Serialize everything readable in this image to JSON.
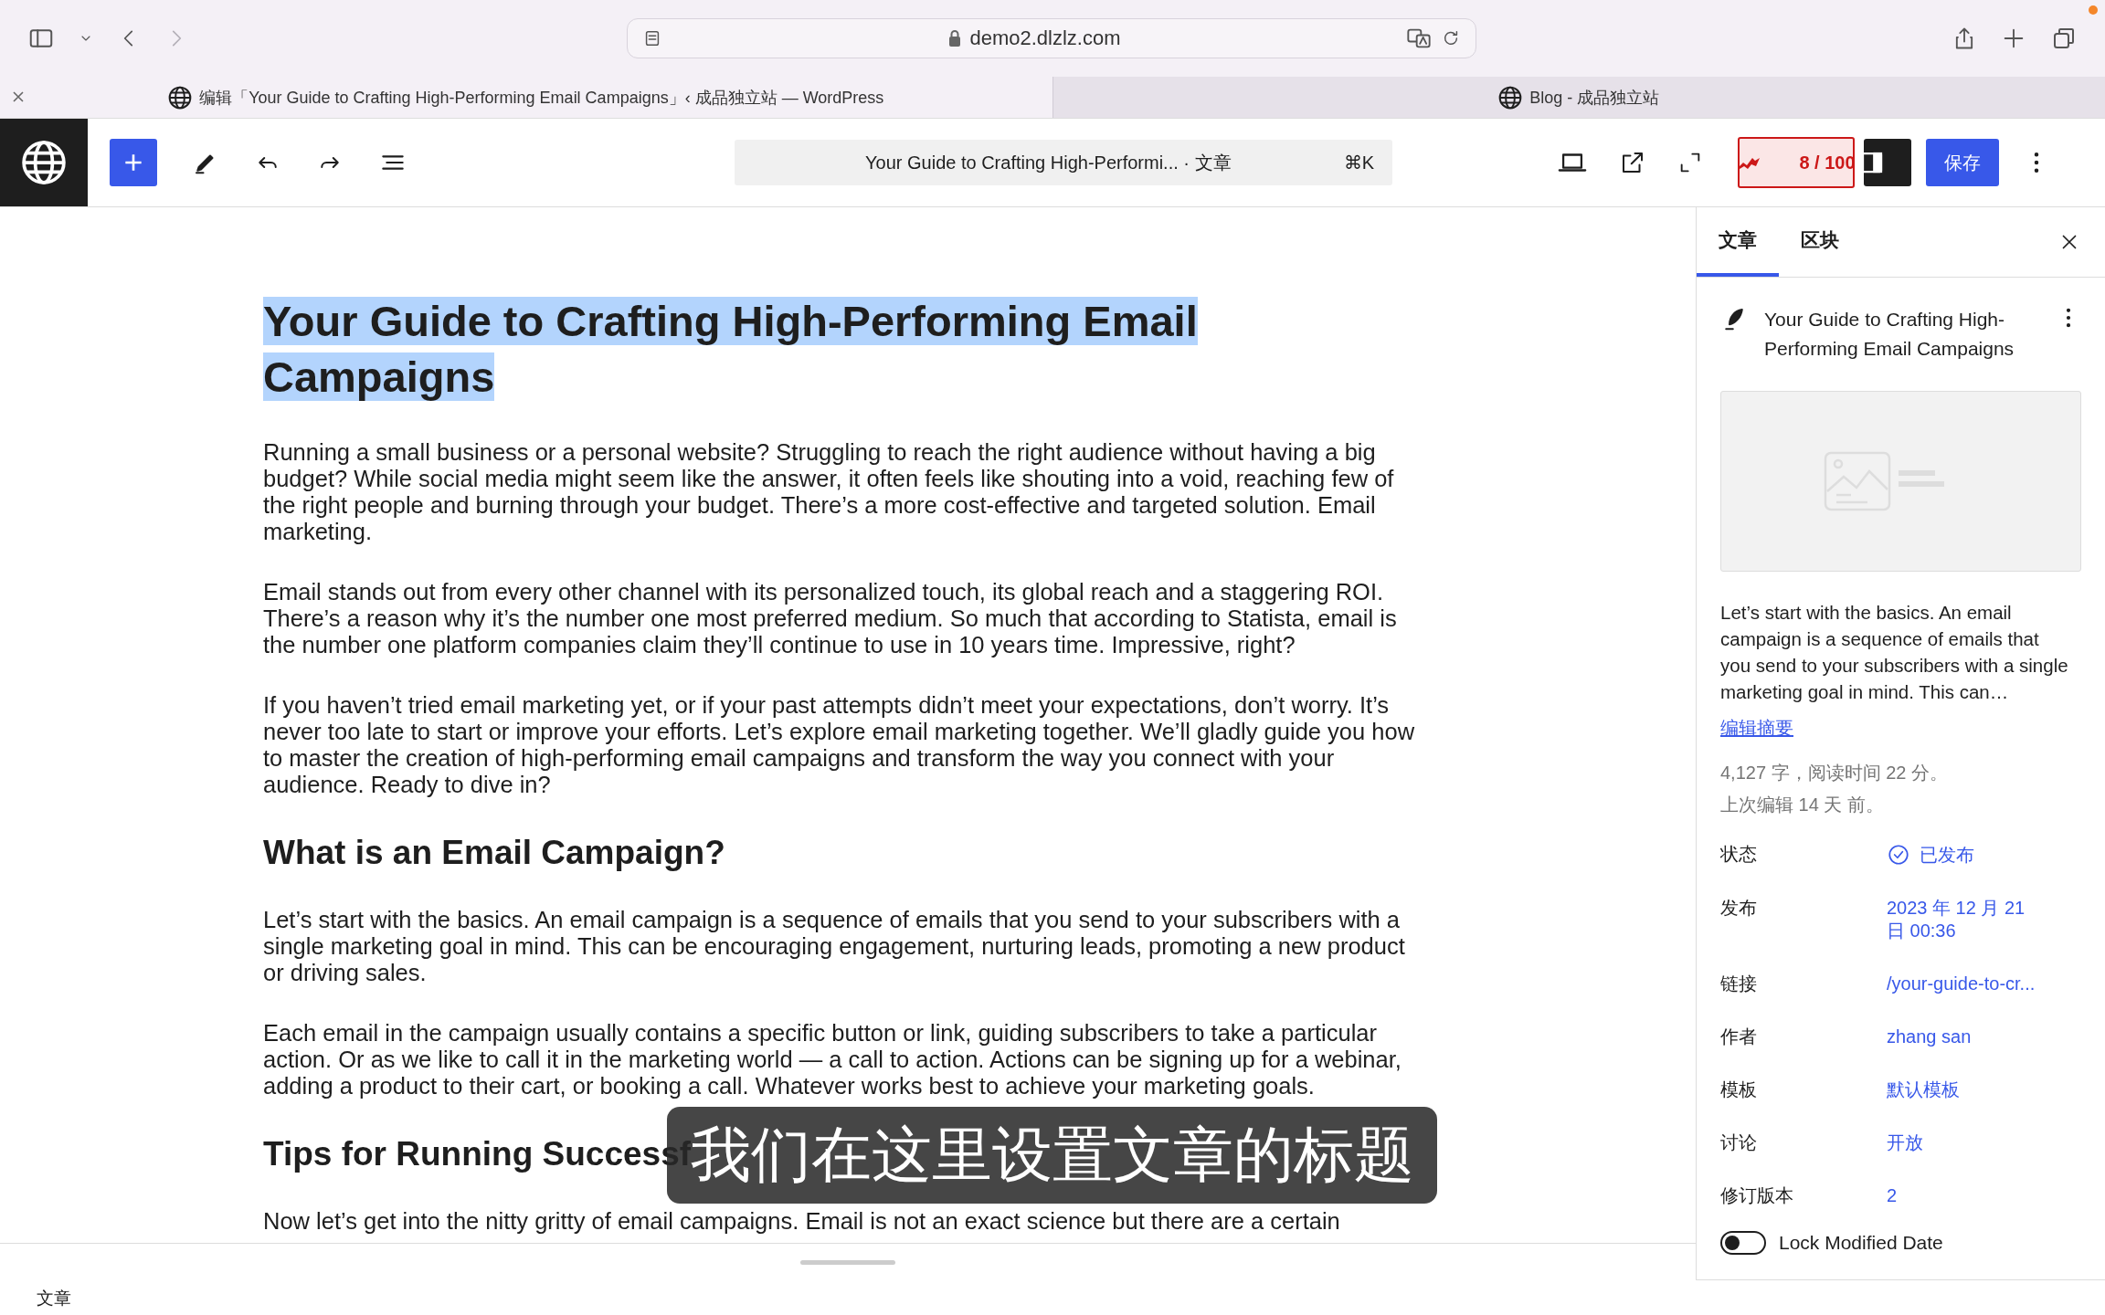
{
  "browser": {
    "address": "demo2.dlzlz.com",
    "tabs": [
      {
        "title": "编辑「Your Guide to Crafting High-Performing Email Campaigns」‹ 成品独立站 — WordPress",
        "selected": true
      },
      {
        "title": "Blog - 成品独立站",
        "selected": false
      }
    ]
  },
  "toolbar": {
    "command_bar": {
      "title": "Your Guide to Crafting High-Performi...",
      "separator": "·",
      "type": "文章",
      "shortcut": "⌘K"
    },
    "score": "8 / 100",
    "settings_pressed": true,
    "save": "保存"
  },
  "editor": {
    "title": {
      "text": "Your Guide to Crafting High-Performing Email Campaigns",
      "selected": true
    },
    "blocks": [
      {
        "kind": "paragraph",
        "text": "Running a small business or a personal website? Struggling to reach the right audience without having a big budget? While social media might seem like the answer, it often feels like shouting into a void, reaching few of the right people and burning through your budget. There’s a more cost-effective and targeted solution. Email marketing."
      },
      {
        "kind": "paragraph",
        "text": "Email stands out from every other channel with its personalized touch, its global reach and a staggering ROI. There’s a reason why it’s the number one most preferred medium. So much that according to Statista, email is the number one platform companies claim they’ll continue to use in 10 years time. Impressive, right?"
      },
      {
        "kind": "paragraph",
        "text": "If you haven’t tried email marketing yet, or if your past attempts didn’t meet your expectations, don’t worry. It’s never too late to start or improve your efforts. Let’s explore email marketing together. We’ll gladly guide you how to master the creation of high-performing email campaigns and transform the way you connect with your audience. Ready to dive in?"
      },
      {
        "kind": "heading",
        "text": "What is an Email Campaign?"
      },
      {
        "kind": "paragraph",
        "text": "Let’s start with the basics. An email campaign is a sequence of emails that you send to your subscribers with a single marketing goal in mind. This can be encouraging engagement, nurturing leads, promoting a new product or driving sales."
      },
      {
        "kind": "paragraph",
        "text": "Each email in the campaign usually contains a specific button or link, guiding subscribers to take a particular action. Or as we like to call it in the marketing world — a call to action. Actions can be signing up for a webinar, adding a product to their cart, or booking a call. Whatever works best to achieve your marketing goals."
      },
      {
        "kind": "heading",
        "text": "Tips for Running Successf"
      },
      {
        "kind": "paragraph",
        "text": "Now let’s get into the nitty gritty of email campaigns. Email is not an exact science but there are a certain"
      }
    ],
    "caption": "我们在这里设置文章的标题"
  },
  "sidebar": {
    "tabs": [
      {
        "label": "文章",
        "selected": true
      },
      {
        "label": "区块",
        "selected": false
      }
    ],
    "post_title": "Your Guide to Crafting High-Performing Email Campaigns",
    "excerpt": "Let’s start with the basics. An email campaign is a sequence of emails that you send to your subscribers with a single marketing goal in mind. This can…",
    "edit_excerpt": "编辑摘要",
    "stats": [
      "4,127 字，阅读时间 22 分。",
      "上次编辑 14 天 前。"
    ],
    "fields": [
      {
        "label": "状态",
        "value": "已发布",
        "kind": "status"
      },
      {
        "label": "发布",
        "value": "2023 年 12 月 21 日 00:36",
        "kind": "link"
      },
      {
        "label": "链接",
        "value": "/your-guide-to-cr...",
        "kind": "link"
      },
      {
        "label": "作者",
        "value": "zhang san",
        "kind": "link"
      },
      {
        "label": "模板",
        "value": "默认模板",
        "kind": "link"
      },
      {
        "label": "讨论",
        "value": "开放",
        "kind": "link"
      },
      {
        "label": "修订版本",
        "value": "2",
        "kind": "link"
      }
    ],
    "lock_modified": {
      "label": "Lock Modified Date",
      "on": false
    }
  },
  "status_bar": "文章"
}
